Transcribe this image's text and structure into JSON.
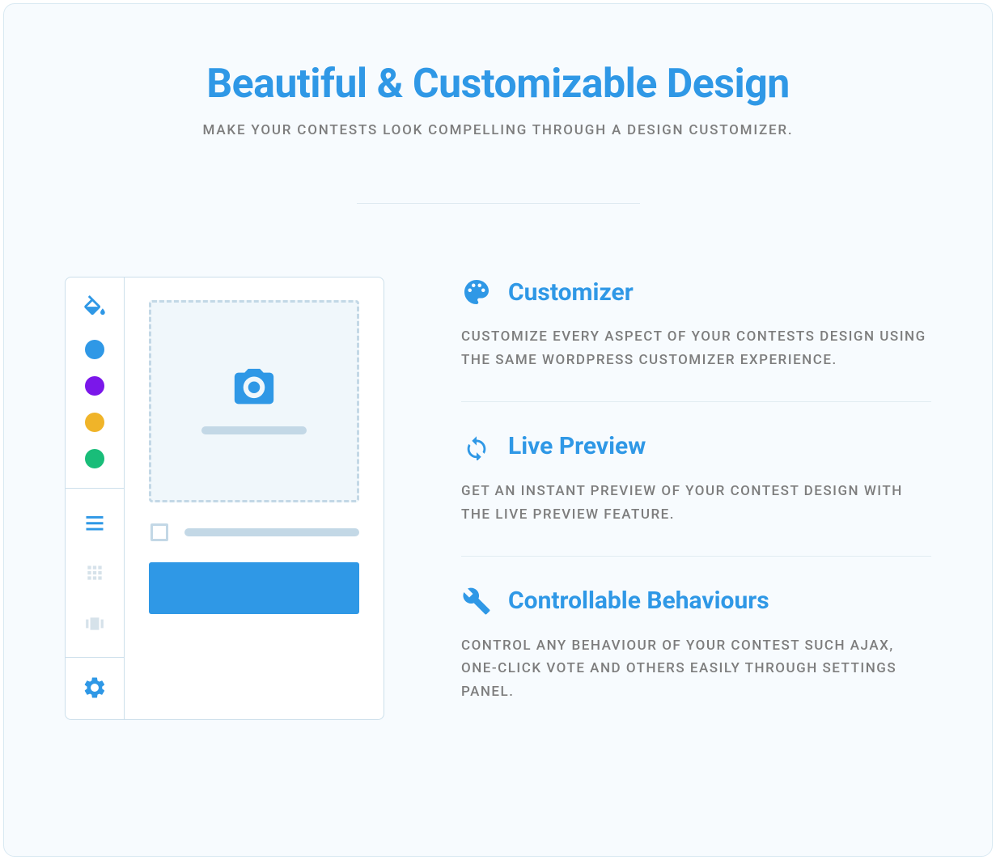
{
  "header": {
    "title": "Beautiful & Customizable Design",
    "subtitle": "MAKE YOUR CONTESTS LOOK COMPELLING THROUGH A DESIGN CUSTOMIZER."
  },
  "features": [
    {
      "icon": "palette-icon",
      "title": "Customizer",
      "desc": "CUSTOMIZE EVERY ASPECT OF YOUR CONTESTS DESIGN USING THE SAME WORDPRESS CUSTOMIZER EXPERIENCE."
    },
    {
      "icon": "refresh-icon",
      "title": "Live Preview",
      "desc": "GET AN INSTANT PREVIEW OF YOUR CONTEST DESIGN WITH THE LIVE PREVIEW FEATURE."
    },
    {
      "icon": "wrench-icon",
      "title": "Controllable Behaviours",
      "desc": "CONTROL ANY BEHAVIOUR OF YOUR CONTEST SUCH AJAX, ONE-CLICK VOTE AND OTHERS EASILY THROUGH SETTINGS PANEL."
    }
  ],
  "colors": {
    "primary": "#2f98e6",
    "swatches": [
      "#2f98e6",
      "#7b17ea",
      "#f0b429",
      "#19bd79"
    ]
  }
}
